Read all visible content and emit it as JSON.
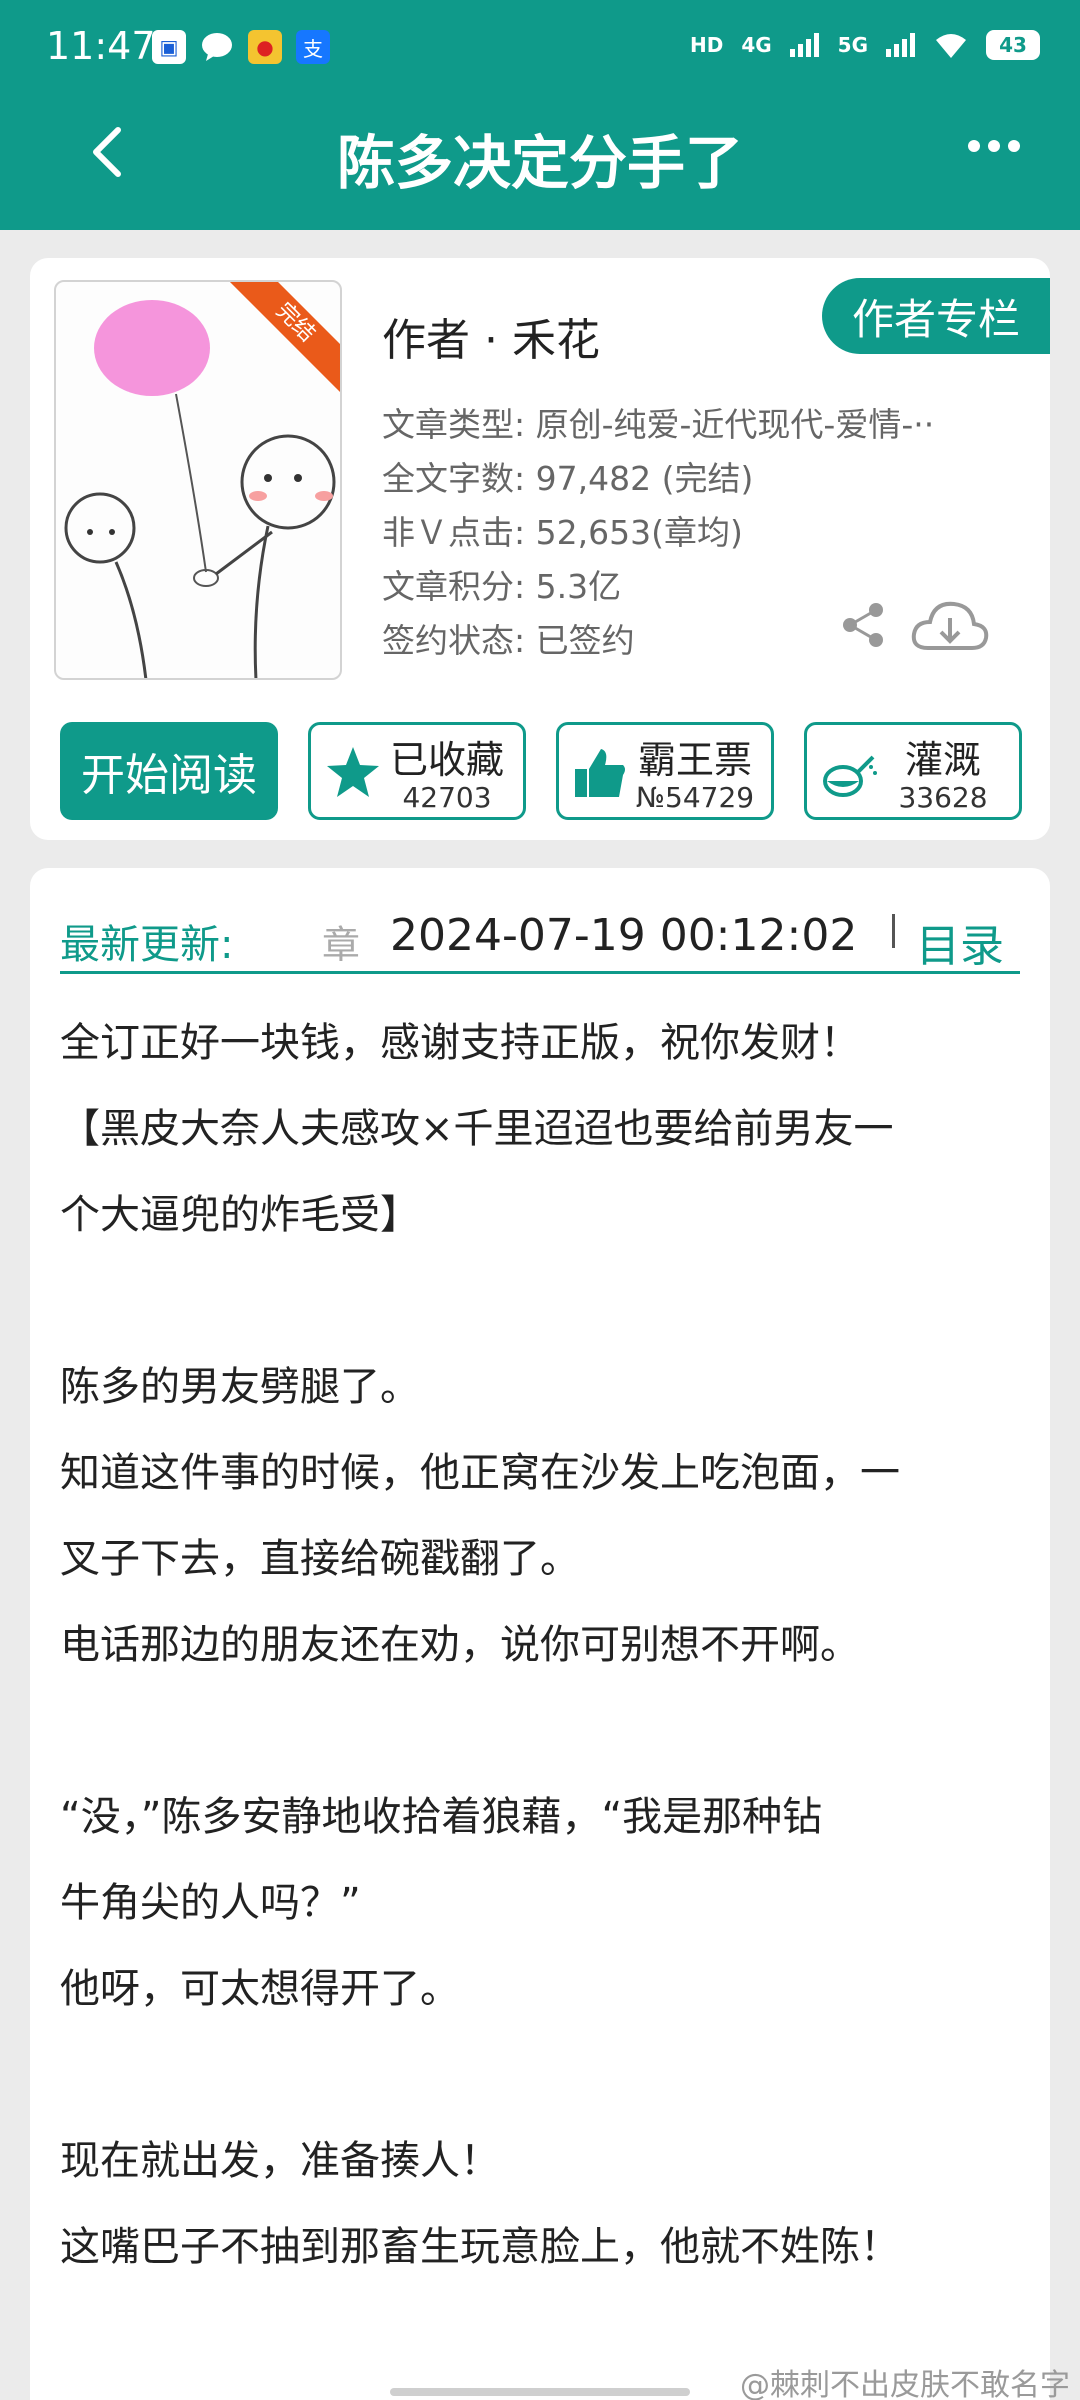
{
  "status_bar": {
    "time": "11:47",
    "app_icons": [
      "news-icon",
      "chat-icon",
      "weibo-icon",
      "alipay-icon"
    ],
    "hd": "HD",
    "signal_4g": "4G",
    "signal_5g": "5G",
    "battery": "43"
  },
  "nav": {
    "title": "陈多决定分手了"
  },
  "book": {
    "author": "作者 · 禾花",
    "column_button": "作者专栏",
    "ribbon": "完结",
    "meta": [
      "文章类型: 原创-纯爱-近代现代-爱情-··",
      "全文字数: 97,482 (完结)",
      "非Ｖ点击: 52,653(章均)",
      "文章积分: 5.3亿",
      "签约状态: 已签约"
    ]
  },
  "actions": {
    "start": "开始阅读",
    "favorite": {
      "label": "已收藏",
      "count": "42703"
    },
    "vote": {
      "label": "霸王票",
      "count": "№54729"
    },
    "water": {
      "label": "灌溉",
      "count": "33628"
    }
  },
  "update": {
    "label": "最新更新:",
    "chapter": "章",
    "datetime": "2024-07-19 00:12:02",
    "toc": "目录"
  },
  "content": [
    "全订正好一块钱，感谢支持正版，祝你发财！",
    "【黑皮大奈人夫感攻×千里迢迢也要给前男友一",
    "个大逼兜的炸毛受】",
    "",
    "陈多的男友劈腿了。",
    "知道这件事的时候，他正窝在沙发上吃泡面，一",
    "叉子下去，直接给碗戳翻了。",
    "电话那边的朋友还在劝，说你可别想不开啊。",
    "",
    "“没，”陈多安静地收拾着狼藉，“我是那种钻",
    "牛角尖的人吗？”",
    "他呀，可太想得开了。",
    "",
    "现在就出发，准备揍人！",
    "这嘴巴子不抽到那畜生玩意脸上，他就不姓陈！"
  ],
  "watermark": "@棘刺不出皮肤不敢名字",
  "colors": {
    "accent": "#0f9a8a",
    "ribbon": "#ea5a1a"
  }
}
